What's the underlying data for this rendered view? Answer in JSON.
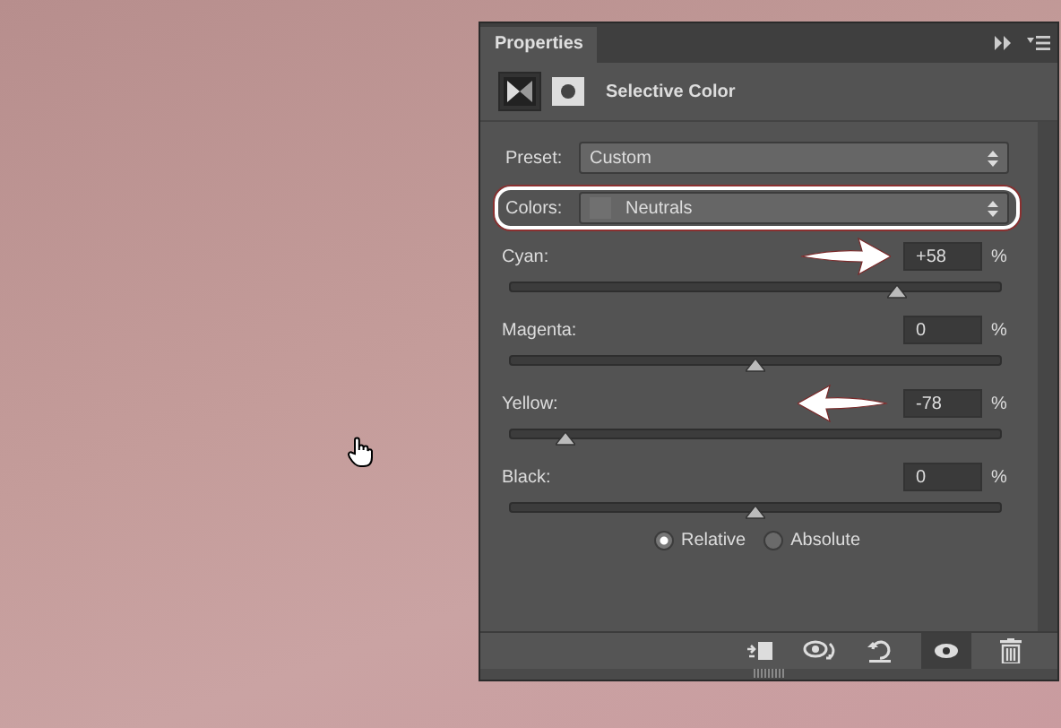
{
  "panel": {
    "tab": "Properties",
    "title": "Selective Color",
    "preset": {
      "label": "Preset:",
      "value": "Custom"
    },
    "colors": {
      "label": "Colors:",
      "value": "Neutrals",
      "highlighted": true
    },
    "sliders": [
      {
        "label": "Cyan:",
        "value": "+58",
        "unit": "%",
        "level": 0.79,
        "kind": "right_arrow"
      },
      {
        "label": "Magenta:",
        "value": "0",
        "unit": "%",
        "level": 0.5,
        "kind": "plain"
      },
      {
        "label": "Yellow:",
        "value": "-78",
        "unit": "%",
        "level": 0.11,
        "kind": "left_arrow"
      },
      {
        "label": "Black:",
        "value": "0",
        "unit": "%",
        "level": 0.5,
        "kind": "plain"
      }
    ],
    "method": [
      {
        "label": "Relative",
        "selected": true
      },
      {
        "label": "Absolute",
        "selected": false
      }
    ]
  }
}
